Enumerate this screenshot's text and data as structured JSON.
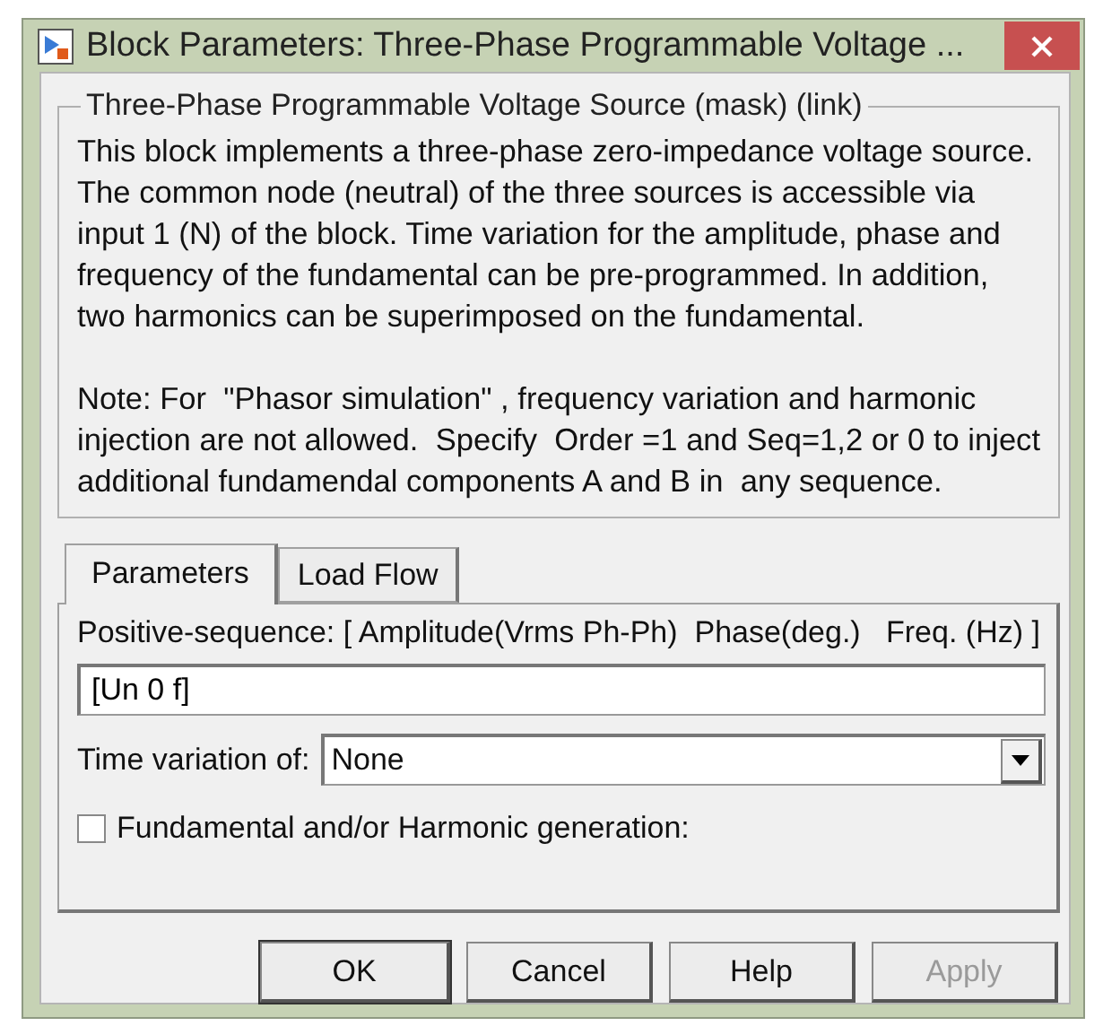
{
  "window": {
    "title": "Block Parameters: Three-Phase Programmable Voltage ..."
  },
  "group": {
    "title": "Three-Phase Programmable Voltage Source (mask) (link)",
    "paragraphs": [
      "This block implements a three-phase zero-impedance voltage source. The common node (neutral) of the three sources is accessible via input 1 (N) of the block. Time variation for the amplitude, phase and frequency of the fundamental can be pre-programmed. In addition, two harmonics can be superimposed on the fundamental.",
      "Note: For  \"Phasor simulation\" , frequency variation and harmonic injection are not allowed.  Specify  Order =1 and Seq=1,2 or 0 to inject additional fundamendal components A and B in  any sequence."
    ]
  },
  "tabs": [
    {
      "label": "Parameters",
      "selected": true
    },
    {
      "label": "Load Flow",
      "selected": false
    }
  ],
  "parameters": [
    {
      "kind": "text",
      "label": "Positive-sequence: [ Amplitude(Vrms Ph-Ph)  Phase(deg.)   Freq. (Hz) ]",
      "value": "[Un 0 f]"
    },
    {
      "kind": "select",
      "label": "Time variation of:",
      "value": "None"
    },
    {
      "kind": "checkbox",
      "label": "Fundamental and/or Harmonic generation:",
      "checked": false
    }
  ],
  "buttons": [
    {
      "label": "OK",
      "disabled": false
    },
    {
      "label": "Cancel",
      "disabled": false
    },
    {
      "label": "Help",
      "disabled": false
    },
    {
      "label": "Apply",
      "disabled": true
    }
  ]
}
